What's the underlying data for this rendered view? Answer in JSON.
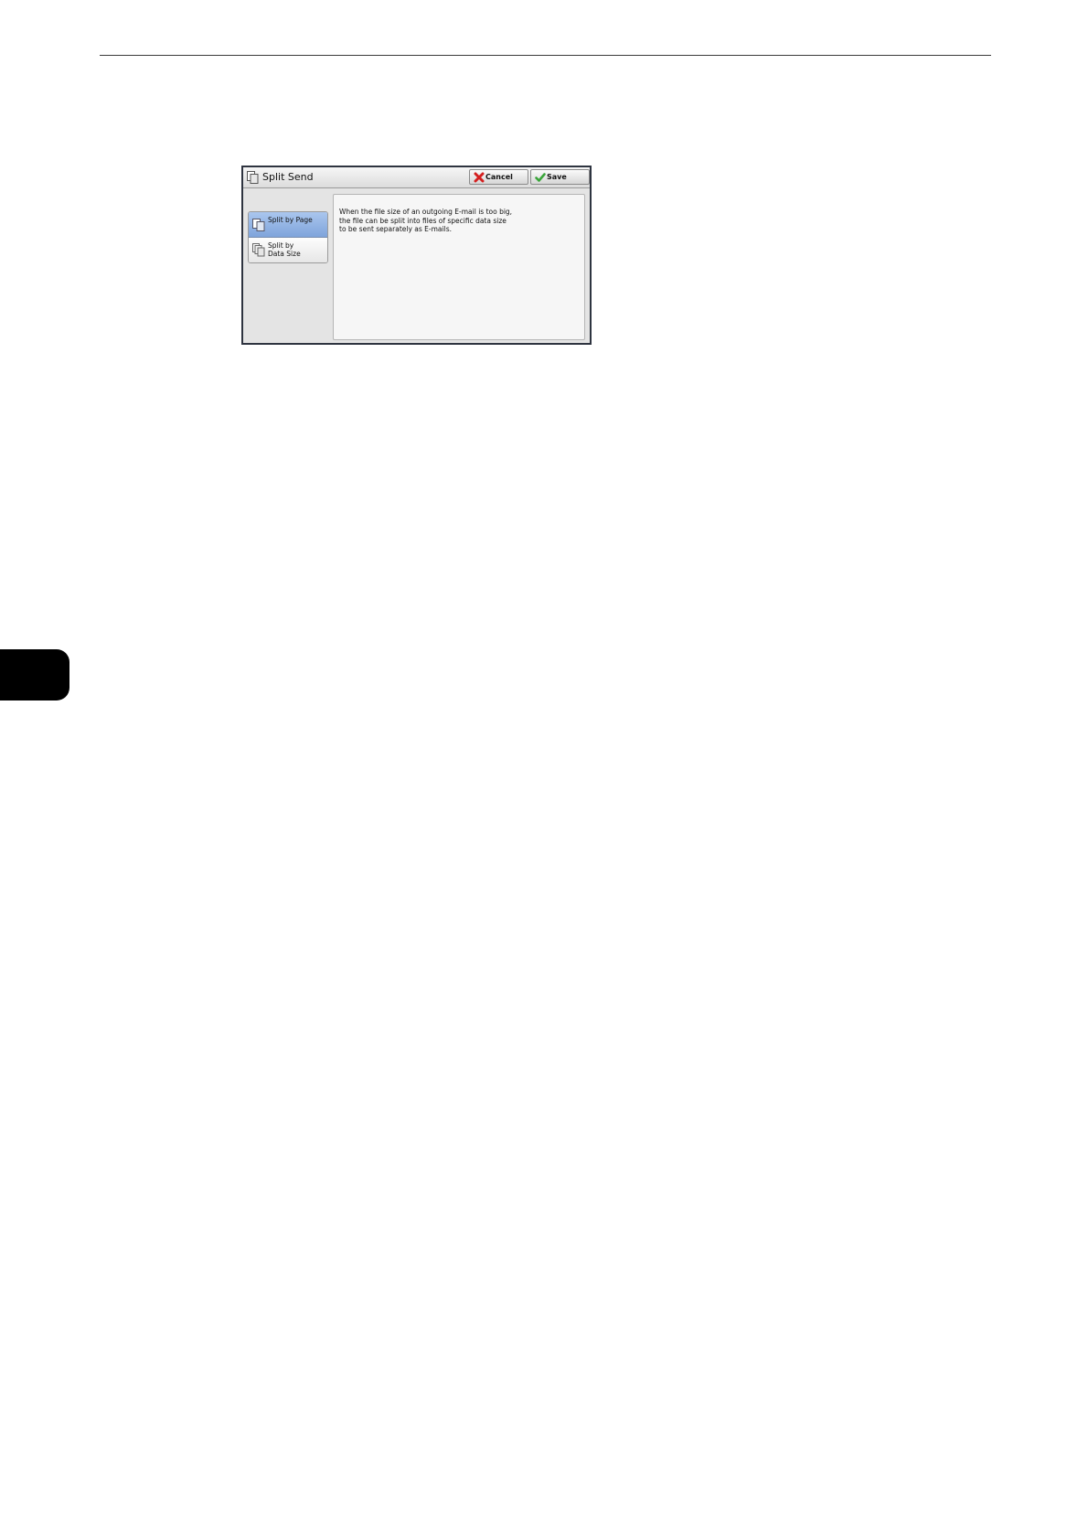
{
  "dialog": {
    "title": "Split Send",
    "title_icon": "split-send-icon",
    "buttons": {
      "cancel_label": "Cancel",
      "cancel_icon": "x-icon",
      "cancel_icon_color": "#d42020",
      "save_label": "Save",
      "save_icon": "check-icon",
      "save_icon_color": "#3aa53a"
    },
    "options": [
      {
        "label": "Split by Page",
        "icon": "pages-icon",
        "selected": true
      },
      {
        "label": "Split by\nData Size",
        "icon": "stacked-pages-icon",
        "selected": false
      }
    ],
    "description": "When the file size of an outgoing E-mail is too big,\nthe file can be split into files of specific data size\nto be sent separately as E-mails.",
    "selected_color": "#8fb1e4"
  }
}
